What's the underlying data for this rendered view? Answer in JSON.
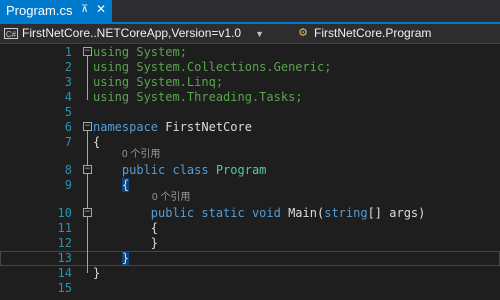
{
  "tab": {
    "title": "Program.cs",
    "pin_glyph": "⊼",
    "close_glyph": "✕"
  },
  "nav": {
    "project": "FirstNetCore..NETCoreApp,Version=v1.0",
    "member": "FirstNetCore.Program"
  },
  "lines": [
    {
      "num": "1",
      "code": [
        [
          "using",
          "using"
        ],
        [
          " System;",
          "using"
        ]
      ]
    },
    {
      "num": "2",
      "code": [
        [
          "using",
          "using"
        ],
        [
          " System.Collections.Generic;",
          "using"
        ]
      ]
    },
    {
      "num": "3",
      "code": [
        [
          "using",
          "using"
        ],
        [
          " System.Linq;",
          "using"
        ]
      ]
    },
    {
      "num": "4",
      "code": [
        [
          "using",
          "using"
        ],
        [
          " System.Threading.Tasks;",
          "using"
        ]
      ]
    },
    {
      "num": "5",
      "code": []
    },
    {
      "num": "6",
      "code": [
        [
          "namespace",
          "kw"
        ],
        [
          " FirstNetCore",
          "ident"
        ]
      ]
    },
    {
      "num": "7",
      "code": [
        [
          "{",
          "ident"
        ]
      ]
    },
    {
      "num": "8",
      "code": [
        [
          "    public",
          "kw"
        ],
        [
          " class",
          "kw"
        ],
        [
          " Program",
          "t"
        ]
      ]
    },
    {
      "num": "9",
      "code": [
        [
          "    {",
          "ident"
        ]
      ]
    },
    {
      "num": "10",
      "code": [
        [
          "        public",
          "kw"
        ],
        [
          " static",
          "kw"
        ],
        [
          " void",
          "kw"
        ],
        [
          " Main(",
          "ident"
        ],
        [
          "string",
          "kw"
        ],
        [
          "[] args)",
          "ident"
        ]
      ]
    },
    {
      "num": "11",
      "code": [
        [
          "        {",
          "ident"
        ]
      ]
    },
    {
      "num": "12",
      "code": [
        [
          "        }",
          "ident"
        ]
      ]
    },
    {
      "num": "13",
      "code": [
        [
          "    }",
          "ident"
        ]
      ]
    },
    {
      "num": "14",
      "code": [
        [
          "}",
          "ident"
        ]
      ]
    },
    {
      "num": "15",
      "code": []
    }
  ],
  "codelens": {
    "class_refs": "0 个引用",
    "method_refs": "0 个引用"
  },
  "colors": {
    "accent": "#007acc",
    "keyword": "#569cd6",
    "type": "#4ec9b0",
    "line_number": "#2b91af",
    "using_grey": "#57a64a"
  },
  "icons": {
    "file_icon": "csharp-project-icon",
    "class_icon": "class-icon",
    "dropdown": "chevron-down-icon"
  }
}
